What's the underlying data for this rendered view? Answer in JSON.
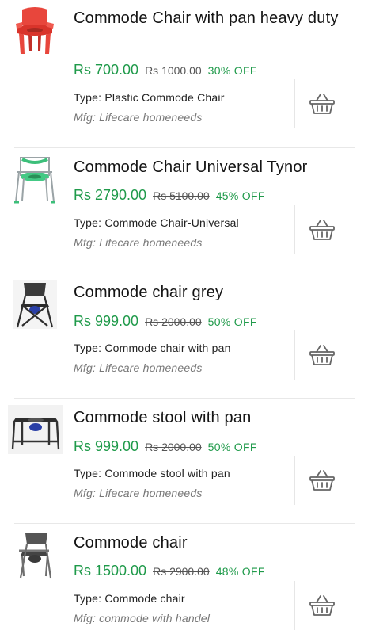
{
  "products": [
    {
      "name": "Commode Chair with pan heavy duty",
      "price": "Rs 700.00",
      "mrp": "Rs 1000.00",
      "discount": "30% OFF",
      "type": "Type: Plastic Commode Chair",
      "mfg": "Mfg: Lifecare homeneeds",
      "image_icon": "red-plastic-chair"
    },
    {
      "name": "Commode Chair Universal Tynor",
      "price": "Rs 2790.00",
      "mrp": "Rs 5100.00",
      "discount": "45% OFF",
      "type": "Type: Commode Chair-Universal",
      "mfg": "Mfg: Lifecare homeneeds",
      "image_icon": "green-commode-frame"
    },
    {
      "name": "Commode chair grey",
      "price": "Rs 999.00",
      "mrp": "Rs 2000.00",
      "discount": "50% OFF",
      "type": "Type: Commode chair with pan",
      "mfg": "Mfg: Lifecare homeneeds",
      "image_icon": "folding-chair"
    },
    {
      "name": "Commode stool with pan",
      "price": "Rs 999.00",
      "mrp": "Rs 2000.00",
      "discount": "50% OFF",
      "type": "Type: Commode stool with pan",
      "mfg": "Mfg: Lifecare homeneeds",
      "image_icon": "commode-stool"
    },
    {
      "name": "Commode chair",
      "price": "Rs 1500.00",
      "mrp": "Rs 2900.00",
      "discount": "48% OFF",
      "type": "Type: Commode chair",
      "mfg": "Mfg: commode with handel",
      "image_icon": "steel-commode-chair"
    }
  ],
  "cart_icon": "basket-icon",
  "colors": {
    "price_green": "#1f9a4a",
    "text": "#141414",
    "muted": "#777777",
    "divider": "#e8e8e8"
  }
}
